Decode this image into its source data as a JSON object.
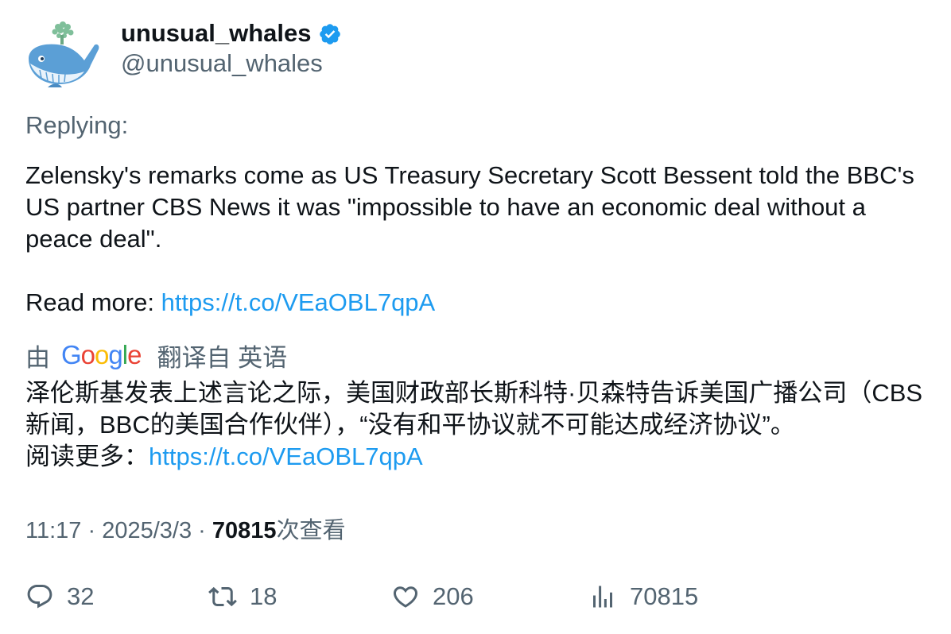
{
  "author": {
    "display_name": "unusual_whales",
    "handle": "@unusual_whales",
    "avatar_icon": "whale-avatar",
    "verified_icon": "verified-badge-icon",
    "verified_color": "#1d9bf0"
  },
  "replying_label": "Replying:",
  "tweet": {
    "text": "Zelensky's remarks come as US Treasury Secretary Scott Bessent told the BBC's US partner CBS News it was \"impossible to have an economic deal without a peace deal\".\n\nRead more: ",
    "link": "https://t.co/VEaOBL7qpA"
  },
  "translation": {
    "by_label": "由",
    "provider": "Google",
    "from_label": "翻译自 英语",
    "text": "泽伦斯基发表上述言论之际，美国财政部长斯科特·贝森特告诉美国广播公司（CBS新闻，BBC的美国合作伙伴），“没有和平协议就不可能达成经济协议”。\n阅读更多：",
    "link": "https://t.co/VEaOBL7qpA"
  },
  "meta": {
    "time": "11:17",
    "date": "2025/3/3",
    "separator": "·",
    "views_count": "70815",
    "views_label": "次查看"
  },
  "actions": {
    "replies": "32",
    "retweets": "18",
    "likes": "206",
    "views": "70815"
  },
  "colors": {
    "link": "#1d9bf0",
    "secondary_text": "#536471",
    "primary_text": "#0f1419"
  }
}
